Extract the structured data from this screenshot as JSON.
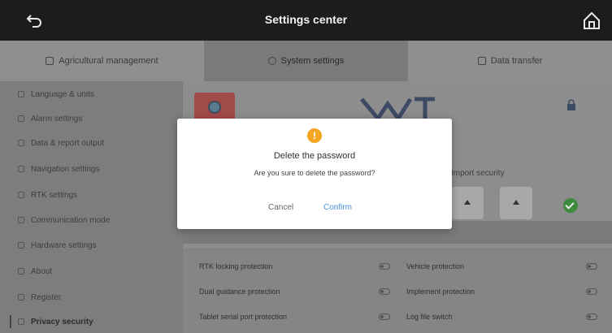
{
  "titlebar": {
    "title": "Settings center",
    "back_icon": "back-icon",
    "home_icon": "home-icon"
  },
  "tabs": [
    {
      "label": "Agricultural management",
      "icon": "list-icon",
      "active": false
    },
    {
      "label": "System settings",
      "icon": "gear-icon",
      "active": true
    },
    {
      "label": "Data transfer",
      "icon": "transfer-icon",
      "active": false
    }
  ],
  "sidebar": {
    "items": [
      {
        "label": "Language & units"
      },
      {
        "label": "Alarm settings"
      },
      {
        "label": "Data & report output"
      },
      {
        "label": "Navigation settings"
      },
      {
        "label": "RTK settings"
      },
      {
        "label": "Communication mode"
      },
      {
        "label": "Hardware settings"
      },
      {
        "label": "About"
      },
      {
        "label": "Register"
      },
      {
        "label": "Privacy security"
      }
    ]
  },
  "main": {
    "security_label": "Import security",
    "protections": [
      [
        "RTK locking protection",
        "Vehicle protection"
      ],
      [
        "Dual guidance protection",
        "Implement protection"
      ],
      [
        "Tablet serial port protection",
        "Log file switch"
      ]
    ]
  },
  "dialog": {
    "title": "Delete the password",
    "message": "Are you sure to delete the password?",
    "cancel_label": "Cancel",
    "confirm_label": "Confirm",
    "warn_icon": "warning-icon",
    "warn_color": "#f5a623",
    "confirm_color": "#4a90d9"
  }
}
